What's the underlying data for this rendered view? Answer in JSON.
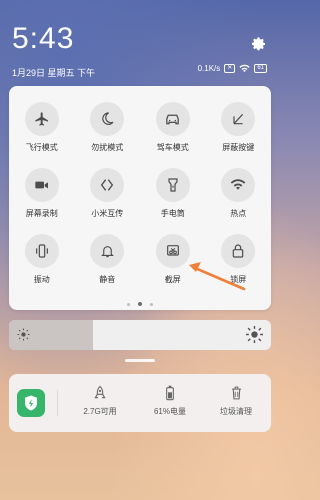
{
  "status": {
    "time": "5:43",
    "date": "1月29日 星期五 下午",
    "net_speed": "0.1K/s",
    "battery": "61"
  },
  "quick_tiles": [
    {
      "label": "飞行模式",
      "icon": "airplane-icon"
    },
    {
      "label": "勿扰模式",
      "icon": "moon-icon"
    },
    {
      "label": "驾车模式",
      "icon": "car-icon"
    },
    {
      "label": "屏蔽按键",
      "icon": "block-keys-icon"
    },
    {
      "label": "屏幕录制",
      "icon": "video-camera-icon"
    },
    {
      "label": "小米互传",
      "icon": "mi-share-icon"
    },
    {
      "label": "手电筒",
      "icon": "flashlight-icon"
    },
    {
      "label": "热点",
      "icon": "hotspot-icon"
    },
    {
      "label": "振动",
      "icon": "vibrate-icon"
    },
    {
      "label": "静音",
      "icon": "bell-icon"
    },
    {
      "label": "截屏",
      "icon": "screenshot-icon"
    },
    {
      "label": "锁屏",
      "icon": "lock-icon"
    }
  ],
  "page_indicator": {
    "count": 3,
    "active_index": 1
  },
  "brightness": {
    "level": 0.32
  },
  "cleaner": {
    "memory": "2.7G可用",
    "battery": "61%电量",
    "trash": "垃圾清理"
  },
  "colors": {
    "accent_arrow": "#ef7f3a",
    "shield_green": "#36b56b"
  }
}
